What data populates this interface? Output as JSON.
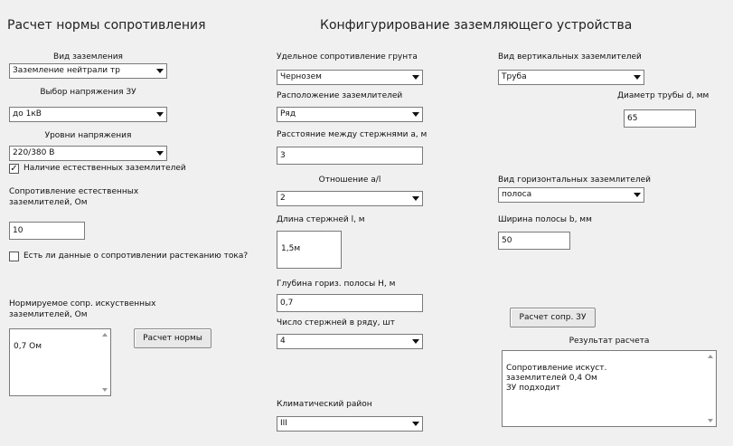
{
  "titles": {
    "left": "Расчет нормы сопротивления",
    "right": "Конфигурирование заземляющего устройства"
  },
  "left": {
    "object_type": {
      "label": "Вид заземления",
      "value": "Заземление нейтрали тр"
    },
    "voltage_select": {
      "label": "Выбор напряжения ЗУ",
      "value": "до 1кВ"
    },
    "voltage_level": {
      "label": "Уровни напряжения",
      "value": "220/380 В"
    },
    "natural_checkbox": {
      "label": "Наличие естественных заземлителей",
      "checked": true
    },
    "natural_resistance": {
      "label": "Сопротивление естественных заземлителей, Ом",
      "value": "10"
    },
    "second_checkbox": {
      "label": "Есть ли данные о сопротивлении растеканию тока?",
      "checked": false
    },
    "normative": {
      "label": "Нормируемое сопр. искуственных заземлителей, Ом",
      "value": "0,7 Ом"
    },
    "calc_norm_button": "Расчет нормы"
  },
  "middle": {
    "soil_resistance": {
      "label": "Удельное сопротивление грунта",
      "value": "Чернозем"
    },
    "arrangement": {
      "label": "Расположение заземлителей",
      "value": "Ряд"
    },
    "distance": {
      "label": "Расстояние между стержнями а, м",
      "value": "3"
    },
    "ratio": {
      "label": "Отношение a/l",
      "value": "2"
    },
    "rod_length": {
      "label": "Длина стержней l, м",
      "value": "1,5м"
    },
    "depth": {
      "label": "Глубина гориз. полосы H, м",
      "value": "0,7"
    },
    "rod_count": {
      "label": "Число стержней в ряду, шт",
      "value": "4"
    },
    "climate": {
      "label": "Климатический район",
      "value": "III"
    }
  },
  "right": {
    "vertical_type": {
      "label": "Вид вертикальных заземлителей",
      "value": "Труба"
    },
    "pipe_diameter": {
      "label": "Диаметр трубы d, мм",
      "value": "65"
    },
    "horizontal_type": {
      "label": "Вид горизонтальных заземлителей",
      "value": "полоса"
    },
    "strip_width": {
      "label": "Ширина полосы b, мм",
      "value": "50"
    },
    "calc_button": "Расчет сопр. ЗУ",
    "result": {
      "label": "Результат расчета",
      "text": "Сопротивление искуст.\nзаземлителей 0,4 Ом\nЗУ подходит"
    }
  }
}
